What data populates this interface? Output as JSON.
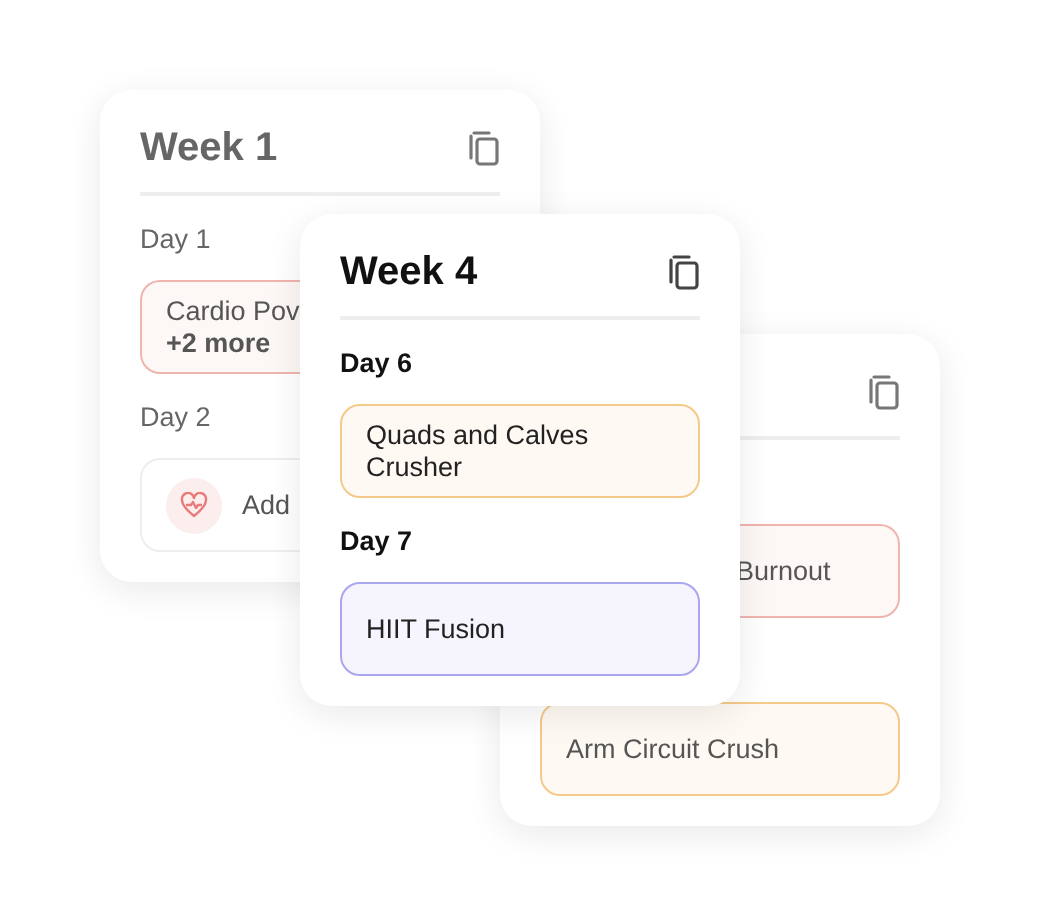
{
  "cards": [
    {
      "title": "Week 1",
      "dimmed": true,
      "days": [
        {
          "label": "Day 1",
          "entry": {
            "kind": "workout",
            "text": "Cardio Pov",
            "more": "+2 more",
            "color": "#f0b4ae"
          }
        },
        {
          "label": "Day 2",
          "entry": {
            "kind": "add",
            "text": "Add"
          }
        }
      ]
    },
    {
      "dimmed": true,
      "days": [
        {
          "entry": {
            "kind": "workout",
            "text": "Burnout",
            "color": "#f0b4ae"
          }
        },
        {
          "entry": {
            "kind": "workout",
            "text": "Arm Circuit Crush",
            "color": "#f5c98a"
          }
        }
      ]
    },
    {
      "title": "Week 4",
      "dimmed": false,
      "days": [
        {
          "label": "Day 6",
          "entry": {
            "kind": "workout",
            "text": "Quads and Calves Crusher",
            "color": "#f5c98a"
          }
        },
        {
          "label": "Day 7",
          "entry": {
            "kind": "workout",
            "text": "HIIT Fusion",
            "color": "#a9a6ee"
          }
        }
      ]
    }
  ]
}
